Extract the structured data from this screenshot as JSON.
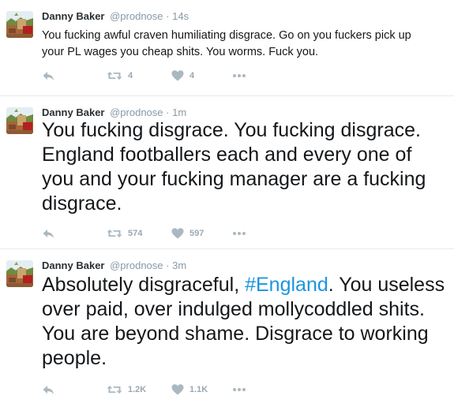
{
  "colors": {
    "accent": "#1b95e0",
    "name": "#292f33",
    "meta": "#8899a6",
    "icon": "#aab8c2"
  },
  "icons": [
    "reply-icon",
    "retweet-icon",
    "like-icon",
    "more-icon"
  ],
  "tweets": [
    {
      "name": "Danny Baker",
      "handle": "@prodnose",
      "dot": "·",
      "time": "14s",
      "text": "You fucking awful craven humiliating disgrace. Go on you fuckers pick up your PL wages you cheap shits. You worms. Fuck you.",
      "retweets": "4",
      "likes": "4"
    },
    {
      "name": "Danny Baker",
      "handle": "@prodnose",
      "dot": "·",
      "time": "1m",
      "text": "You fucking disgrace. You fucking disgrace. England footballers each and every one of you and your fucking manager are a fucking disgrace.",
      "retweets": "574",
      "likes": "597"
    },
    {
      "name": "Danny Baker",
      "handle": "@prodnose",
      "dot": "·",
      "time": "3m",
      "text_before": "Absolutely disgraceful, ",
      "hashtag": "#England",
      "text_after": ". You useless over paid, over indulged mollycoddled shits. You are beyond shame. Disgrace to working people.",
      "retweets": "1.2K",
      "likes": "1.1K"
    }
  ]
}
